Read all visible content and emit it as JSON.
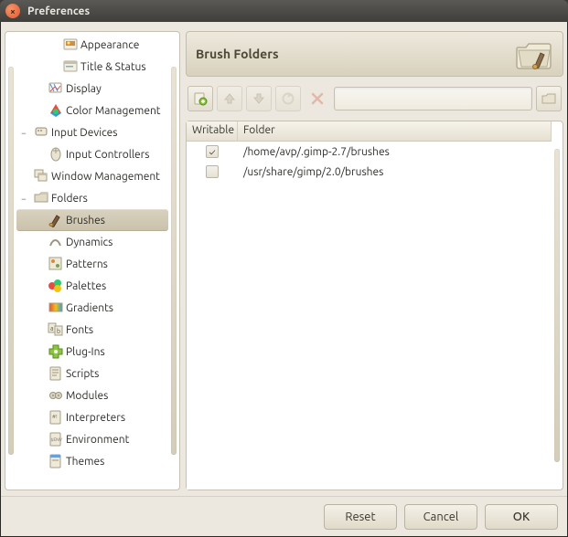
{
  "window": {
    "title": "Preferences",
    "close_glyph": "×"
  },
  "sidebar": {
    "items": [
      {
        "depth": 2,
        "expander": "",
        "icon": "appearance",
        "label": "Appearance"
      },
      {
        "depth": 2,
        "expander": "",
        "icon": "titlestatus",
        "label": "Title & Status"
      },
      {
        "depth": 1,
        "expander": "",
        "icon": "display",
        "label": "Display"
      },
      {
        "depth": 1,
        "expander": "",
        "icon": "colormgmt",
        "label": "Color Management"
      },
      {
        "depth": 0,
        "expander": "−",
        "icon": "inputdev",
        "label": "Input Devices"
      },
      {
        "depth": 1,
        "expander": "",
        "icon": "controllers",
        "label": "Input Controllers"
      },
      {
        "depth": 0,
        "expander": "",
        "icon": "winmgmt",
        "label": "Window Management"
      },
      {
        "depth": 0,
        "expander": "−",
        "icon": "folders",
        "label": "Folders"
      },
      {
        "depth": 1,
        "expander": "",
        "icon": "brushes",
        "label": "Brushes",
        "selected": true
      },
      {
        "depth": 1,
        "expander": "",
        "icon": "dynamics",
        "label": "Dynamics"
      },
      {
        "depth": 1,
        "expander": "",
        "icon": "patterns",
        "label": "Patterns"
      },
      {
        "depth": 1,
        "expander": "",
        "icon": "palettes",
        "label": "Palettes"
      },
      {
        "depth": 1,
        "expander": "",
        "icon": "gradients",
        "label": "Gradients"
      },
      {
        "depth": 1,
        "expander": "",
        "icon": "fonts",
        "label": "Fonts"
      },
      {
        "depth": 1,
        "expander": "",
        "icon": "plugins",
        "label": "Plug-Ins"
      },
      {
        "depth": 1,
        "expander": "",
        "icon": "scripts",
        "label": "Scripts"
      },
      {
        "depth": 1,
        "expander": "",
        "icon": "modules",
        "label": "Modules"
      },
      {
        "depth": 1,
        "expander": "",
        "icon": "interp",
        "label": "Interpreters"
      },
      {
        "depth": 1,
        "expander": "",
        "icon": "env",
        "label": "Environment"
      },
      {
        "depth": 1,
        "expander": "",
        "icon": "themes",
        "label": "Themes"
      }
    ]
  },
  "header": {
    "title": "Brush Folders"
  },
  "toolbar": {
    "new": "add",
    "up": "up",
    "down": "down",
    "refresh": "refresh",
    "remove": "remove",
    "browse": "browse"
  },
  "table": {
    "columns": {
      "writable": "Writable",
      "folder": "Folder"
    },
    "rows": [
      {
        "writable": true,
        "path": "/home/avp/.gimp-2.7/brushes"
      },
      {
        "writable": false,
        "path": "/usr/share/gimp/2.0/brushes"
      }
    ]
  },
  "footer": {
    "reset": "Reset",
    "cancel": "Cancel",
    "ok": "OK"
  }
}
